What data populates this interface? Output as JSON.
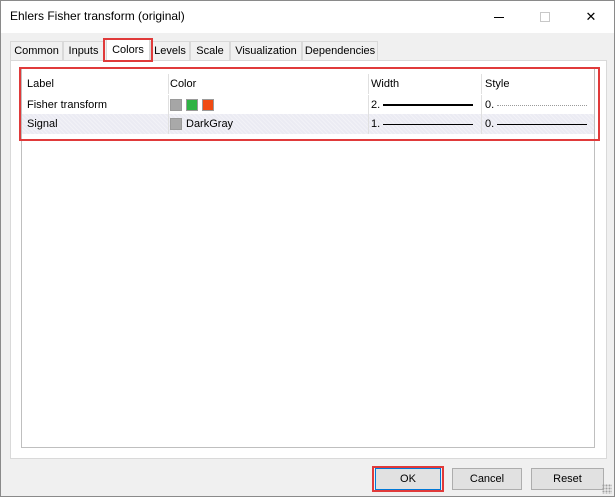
{
  "window": {
    "title": "Ehlers Fisher transform (original)",
    "controls": {
      "minimize": "minimize",
      "maximize": "maximize",
      "close": "✕"
    }
  },
  "tabs": [
    {
      "label": "Common",
      "active": false
    },
    {
      "label": "Inputs",
      "active": false
    },
    {
      "label": "Colors",
      "active": true
    },
    {
      "label": "Levels",
      "active": false
    },
    {
      "label": "Scale",
      "active": false
    },
    {
      "label": "Visualization",
      "active": false
    },
    {
      "label": "Dependencies",
      "active": false
    }
  ],
  "grid": {
    "columns": [
      "Label",
      "Color",
      "Width",
      "Style"
    ],
    "rows": [
      {
        "label": "Fisher transform",
        "colors": [
          "#a6a6a6",
          "#2fb344",
          "#f04a12"
        ],
        "color_name": "",
        "width": "2.",
        "style": "0."
      },
      {
        "label": "Signal",
        "colors": [
          "#a9a9a9"
        ],
        "color_name": "DarkGray",
        "width": "1.",
        "style": "0."
      }
    ]
  },
  "buttons": {
    "ok": "OK",
    "cancel": "Cancel",
    "reset": "Reset"
  },
  "highlight_color": "#e03a3a"
}
